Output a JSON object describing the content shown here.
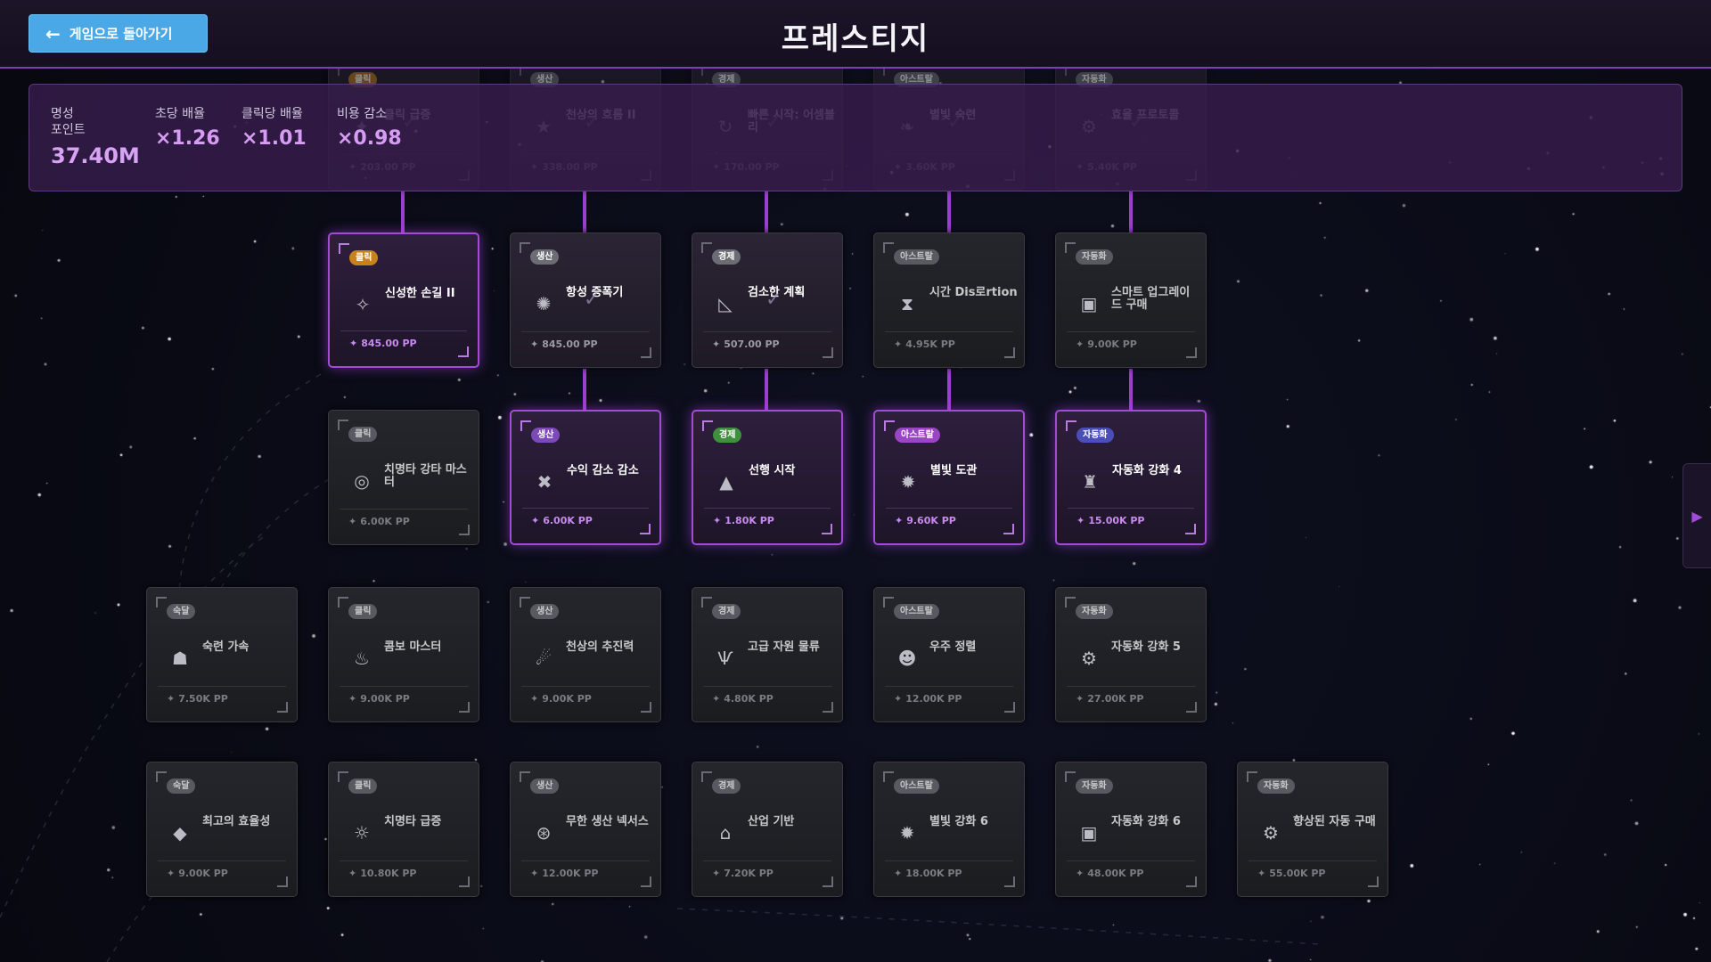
{
  "header": {
    "back_label": "게임으로 돌아가기",
    "back_icon": "arrow-left-icon",
    "title": "프레스티지"
  },
  "stats": {
    "prestige_label": "명성\n포인트",
    "prestige_value": "37.40M",
    "per_sec_label": "초당 배율",
    "per_sec_value": "×1.26",
    "per_click_label": "클릭당 배율",
    "per_click_value": "×1.01",
    "cost_reduce_label": "비용 감소",
    "cost_reduce_value": "×0.98"
  },
  "nodes": [
    {
      "id": "r0c1",
      "badge": "클릭",
      "category": "click",
      "title": "클릭 급증",
      "cost": "203.00 PP",
      "icon": "sparkle-icon",
      "glyph": "✦",
      "state": "owned"
    },
    {
      "id": "r0c2",
      "badge": "생산",
      "category": "prod",
      "title": "천상의 흐름 II",
      "cost": "338.00 PP",
      "icon": "star-icon",
      "glyph": "★",
      "state": "owned"
    },
    {
      "id": "r0c3",
      "badge": "경제",
      "category": "econ",
      "title": "빠른 시작: 어셈블리",
      "cost": "170.00 PP",
      "icon": "cycle-icon",
      "glyph": "↻",
      "state": "owned"
    },
    {
      "id": "r0c4",
      "badge": "아스트랄",
      "category": "astral",
      "title": "별빛 숙련",
      "cost": "3.60K PP",
      "icon": "leaf-icon",
      "glyph": "❧",
      "state": "owned"
    },
    {
      "id": "r0c5",
      "badge": "자동화",
      "category": "auto",
      "title": "효율 프로토콜",
      "cost": "5.40K PP",
      "icon": "gear-icon",
      "glyph": "⚙",
      "state": "owned"
    },
    {
      "id": "r1c1",
      "badge": "클릭",
      "category": "click",
      "title": "신성한 손길 II",
      "cost": "845.00 PP",
      "icon": "sparkle-icon",
      "glyph": "✧",
      "state": "avail"
    },
    {
      "id": "r1c2",
      "badge": "생산",
      "category": "prod",
      "title": "항성 증폭기",
      "cost": "845.00 PP",
      "icon": "burst-icon",
      "glyph": "✺",
      "state": "owned"
    },
    {
      "id": "r1c3",
      "badge": "경제",
      "category": "econ",
      "title": "검소한 계획",
      "cost": "507.00 PP",
      "icon": "chart-icon",
      "glyph": "◺",
      "state": "owned"
    },
    {
      "id": "r1c4",
      "badge": "아스트랄",
      "category": "astral",
      "title": "시간 Dis로rtion",
      "cost": "4.95K PP",
      "icon": "hourglass-icon",
      "glyph": "⧗",
      "state": "dim"
    },
    {
      "id": "r1c5",
      "badge": "자동화",
      "category": "auto",
      "title": "스마트 업그레이드 구매",
      "cost": "9.00K PP",
      "icon": "robot-icon",
      "glyph": "▣",
      "state": "dim"
    },
    {
      "id": "r2c1",
      "badge": "클릭",
      "category": "click",
      "title": "치명타 강타 마스터",
      "cost": "6.00K PP",
      "icon": "target-icon",
      "glyph": "◎",
      "state": "dim"
    },
    {
      "id": "r2c2",
      "badge": "생산",
      "category": "prod",
      "title": "수익 감소 감소",
      "cost": "6.00K PP",
      "icon": "cross-icon",
      "glyph": "✖",
      "state": "avail"
    },
    {
      "id": "r2c3",
      "badge": "경제",
      "category": "econ",
      "title": "선행 시작",
      "cost": "1.80K PP",
      "icon": "ship-icon",
      "glyph": "▲",
      "state": "avail"
    },
    {
      "id": "r2c4",
      "badge": "아스트랄",
      "category": "astral",
      "title": "별빛 도관",
      "cost": "9.60K PP",
      "icon": "orb-icon",
      "glyph": "✹",
      "state": "avail"
    },
    {
      "id": "r2c5",
      "badge": "자동화",
      "category": "auto",
      "title": "자동화 강화 4",
      "cost": "15.00K PP",
      "icon": "rocket-icon",
      "glyph": "♜",
      "state": "avail"
    },
    {
      "id": "r3c0",
      "badge": "숙달",
      "category": "mast",
      "title": "숙련 가속",
      "cost": "7.50K PP",
      "icon": "hand-icon",
      "glyph": "☗",
      "state": "dim"
    },
    {
      "id": "r3c1",
      "badge": "클릭",
      "category": "click",
      "title": "콤보 마스터",
      "cost": "9.00K PP",
      "icon": "flame-icon",
      "glyph": "♨",
      "state": "dim"
    },
    {
      "id": "r3c2",
      "badge": "생산",
      "category": "prod",
      "title": "천상의 추진력",
      "cost": "9.00K PP",
      "icon": "comet-icon",
      "glyph": "☄",
      "state": "dim"
    },
    {
      "id": "r3c3",
      "badge": "경제",
      "category": "econ",
      "title": "고급 자원 물류",
      "cost": "4.80K PP",
      "icon": "wings-icon",
      "glyph": "Ѱ",
      "state": "dim"
    },
    {
      "id": "r3c4",
      "badge": "아스트랄",
      "category": "astral",
      "title": "우주 정렬",
      "cost": "12.00K PP",
      "icon": "face-icon",
      "glyph": "☻",
      "state": "dim"
    },
    {
      "id": "r3c5",
      "badge": "자동화",
      "category": "auto",
      "title": "자동화 강화 5",
      "cost": "27.00K PP",
      "icon": "gear-icon",
      "glyph": "⚙",
      "state": "dim"
    },
    {
      "id": "r4c0",
      "badge": "숙달",
      "category": "mast",
      "title": "최고의 효율성",
      "cost": "9.00K PP",
      "icon": "diamond-icon",
      "glyph": "◆",
      "state": "dim"
    },
    {
      "id": "r4c1",
      "badge": "클릭",
      "category": "click",
      "title": "치명타 급증",
      "cost": "10.80K PP",
      "icon": "sun-icon",
      "glyph": "☼",
      "state": "dim"
    },
    {
      "id": "r4c2",
      "badge": "생산",
      "category": "prod",
      "title": "무한 생산 넥서스",
      "cost": "12.00K PP",
      "icon": "nexus-icon",
      "glyph": "⊛",
      "state": "dim"
    },
    {
      "id": "r4c3",
      "badge": "경제",
      "category": "econ",
      "title": "산업 기반",
      "cost": "7.20K PP",
      "icon": "factory-icon",
      "glyph": "⌂",
      "state": "dim"
    },
    {
      "id": "r4c4",
      "badge": "아스트랄",
      "category": "astral",
      "title": "별빛 강화 6",
      "cost": "18.00K PP",
      "icon": "orb-icon",
      "glyph": "✹",
      "state": "dim"
    },
    {
      "id": "r4c5",
      "badge": "자동화",
      "category": "auto",
      "title": "자동화 강화 6",
      "cost": "48.00K PP",
      "icon": "robot-icon",
      "glyph": "▣",
      "state": "dim"
    },
    {
      "id": "r4c6",
      "badge": "자동화",
      "category": "auto",
      "title": "향상된 자동 구매",
      "cost": "55.00K PP",
      "icon": "gear-icon",
      "glyph": "⚙",
      "state": "dim"
    }
  ],
  "side_tab_icon": "play-arrow-icon"
}
